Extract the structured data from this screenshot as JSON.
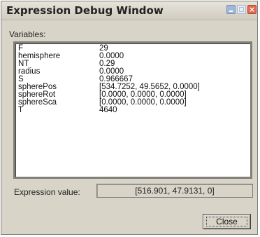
{
  "window": {
    "title": "Expression Debug Window"
  },
  "titlebar_buttons": {
    "minimize_icon": "minimize-icon",
    "maximize_icon": "maximize-icon",
    "close_icon": "close-icon",
    "close_glyph": "×"
  },
  "variables": {
    "label": "Variables:",
    "rows": [
      {
        "name": "F",
        "value": "29"
      },
      {
        "name": "hemisphere",
        "value": "0.0000"
      },
      {
        "name": "NT",
        "value": "0.29"
      },
      {
        "name": "radius",
        "value": "0.0000"
      },
      {
        "name": "S",
        "value": "0.966667"
      },
      {
        "name": "spherePos",
        "value": "[534.7252, 49.5652, 0.0000]"
      },
      {
        "name": "sphereRot",
        "value": "[0.0000, 0.0000, 0.0000]"
      },
      {
        "name": "sphereSca",
        "value": "[0.0000, 0.0000, 0.0000]"
      },
      {
        "name": "T",
        "value": "4640"
      }
    ]
  },
  "expression": {
    "label": "Expression value:",
    "value": "[516.901, 47.9131, 0]"
  },
  "buttons": {
    "close_label": "Close"
  }
}
